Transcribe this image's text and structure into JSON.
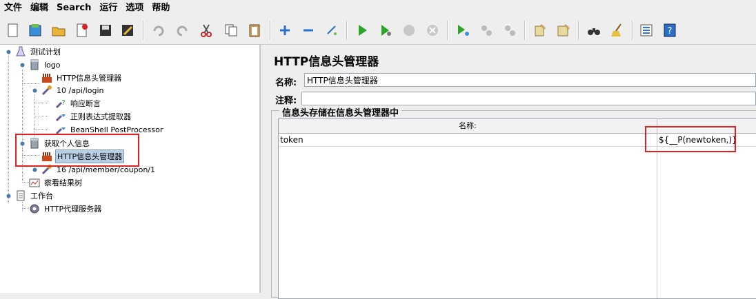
{
  "menu": [
    "文件",
    "编辑",
    "Search",
    "运行",
    "选项",
    "帮助"
  ],
  "tree": {
    "test_plan": "测试计划",
    "logo_group": "logo",
    "header_manager_1": "HTTP信息头管理器",
    "login_sampler": "10 /api/login",
    "response_assertion": "响应断言",
    "regex_extractor": "正则表达式提取器",
    "beanshell_post": "BeanShell PostProcessor",
    "profile_group": "获取个人信息",
    "header_manager_2": "HTTP信息头管理器",
    "coupon_sampler": "16 /api/member/coupon/1",
    "results_tree": "察看结果树",
    "workbench": "工作台",
    "proxy_server": "HTTP代理服务器"
  },
  "panel": {
    "title": "HTTP信息头管理器",
    "name_label": "名称:",
    "name_value": "HTTP信息头管理器",
    "comment_label": "注释:",
    "comment_value": "",
    "group_title": "信息头存储在信息头管理器中",
    "col_name": "名称:",
    "col_value": "",
    "rows": [
      {
        "name": "token",
        "value": "${__P(newtoken,)}"
      }
    ]
  },
  "colors": {
    "highlight": "#e02020",
    "selection": "#b8cfe5"
  }
}
